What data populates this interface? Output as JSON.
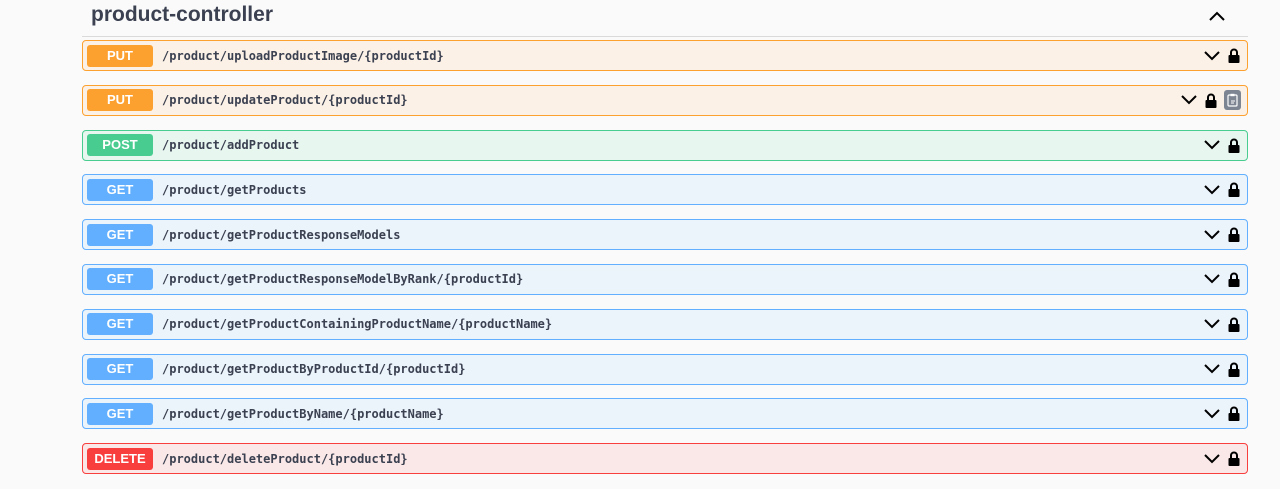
{
  "section": {
    "title": "product-controller"
  },
  "operations": [
    {
      "method": "PUT",
      "path": "/product/uploadProductImage/{productId}"
    },
    {
      "method": "PUT",
      "path": "/product/updateProduct/{productId}"
    },
    {
      "method": "POST",
      "path": "/product/addProduct"
    },
    {
      "method": "GET",
      "path": "/product/getProducts"
    },
    {
      "method": "GET",
      "path": "/product/getProductResponseModels"
    },
    {
      "method": "GET",
      "path": "/product/getProductResponseModelByRank/{productId}"
    },
    {
      "method": "GET",
      "path": "/product/getProductContainingProductName/{productName}"
    },
    {
      "method": "GET",
      "path": "/product/getProductByProductId/{productId}"
    },
    {
      "method": "GET",
      "path": "/product/getProductByName/{productName}"
    },
    {
      "method": "DELETE",
      "path": "/product/deleteProduct/{productId}"
    }
  ],
  "colors": {
    "put": "#fca130",
    "post": "#49cc90",
    "get": "#61affe",
    "delete": "#f93e3e"
  },
  "icons": {
    "collapse": "chevron-up-icon",
    "expand": "chevron-down-icon",
    "auth": "lock-icon",
    "copy": "copy-to-clipboard-icon"
  }
}
